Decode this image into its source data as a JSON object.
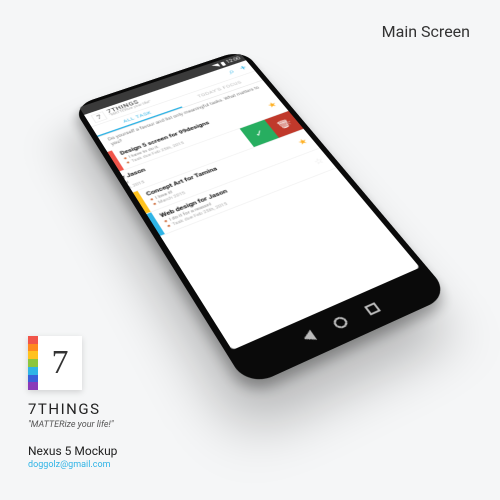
{
  "page": {
    "title": "Main Screen"
  },
  "statusbar": {
    "time": "12:00"
  },
  "actionbar": {
    "title": "7THINGS",
    "subtitle": "\"MATTERize your life!\"",
    "search_icon": "⌕",
    "add_icon": "+"
  },
  "tabs": {
    "all": "ALL TASK",
    "today": "TODAY'S FOCUS"
  },
  "prompt": "Do yourself a favour and list only meaningful tasks. What matters to you?",
  "rows": [
    {
      "color": "#f1554a",
      "title": "Design 5 screen for 99designs",
      "reason": "I have to do it.",
      "due": "Task due Feb 25th, 2015",
      "starred": true
    },
    {
      "color": "#ff8a1e",
      "title": "Web design for Jason",
      "reason": "I do it for a reason!",
      "due": "Task due Feb 25th, 2015",
      "starred": false,
      "swiped": true
    },
    {
      "color": "#ffc21e",
      "title": "Concept Art for Tamina",
      "reason": "I love it!",
      "due": "March 2015",
      "starred": true
    },
    {
      "color": "#2fb4e6",
      "title": "Web design for Jason",
      "reason": "I do it for a reason!",
      "due": "Task due Feb 25th, 2015",
      "starred": false
    }
  ],
  "row_actions": {
    "done": "✓",
    "delete": "🗑"
  },
  "logo_colors": [
    "#f1554a",
    "#ff8a1e",
    "#ffc21e",
    "#8cc63e",
    "#2fb4e6",
    "#3a5fd9",
    "#8a3ab9"
  ],
  "footer": {
    "app_name": "7THINGS",
    "tagline": "\"MATTERize your life!\"",
    "device": "Nexus 5 Mockup",
    "email": "doggolz@gmail.com"
  }
}
